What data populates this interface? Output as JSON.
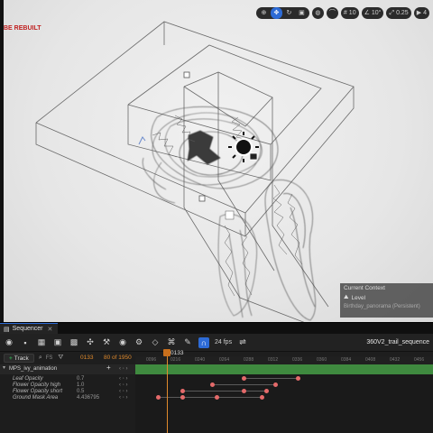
{
  "viewport": {
    "warning": "BE REBUILT",
    "toolbar": {
      "fov": "10",
      "angle": "10°",
      "speed": "0.25",
      "camera": "4"
    },
    "context_panel": {
      "title": "Current Context",
      "row_label": "Level",
      "row_value": "Birthday_panorama (Persistent)"
    }
  },
  "sequencer": {
    "tab_label": "Sequencer",
    "fps": "24 fps",
    "sequence_name": "360V2_trail_sequence",
    "track_button": "Track",
    "fs_label": "FS",
    "current_frame": "0133",
    "total_frames": "80 of 1950",
    "playhead": "0133",
    "ruler_ticks": [
      "0096",
      "0216",
      "0240",
      "0264",
      "0288",
      "0312",
      "0336",
      "0360",
      "0384",
      "0408",
      "0432",
      "0456"
    ],
    "main_track": "MPS_ivy_animation",
    "tracks": [
      {
        "label": "Leaf Opacity",
        "value": "0.7"
      },
      {
        "label": "Flower Opacity high",
        "value": "1.0"
      },
      {
        "label": "Flower Opacity short",
        "value": "0.5"
      },
      {
        "label": "Ground Mask Area",
        "value": "4.436795"
      }
    ]
  }
}
